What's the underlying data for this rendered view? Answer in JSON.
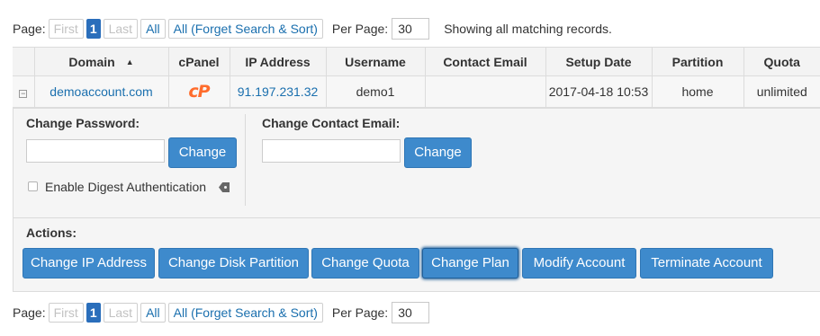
{
  "pager": {
    "page_label": "Page:",
    "first": "First",
    "current_page": "1",
    "last": "Last",
    "all": "All",
    "all_forget": "All (Forget Search & Sort)",
    "per_page_label": "Per Page:",
    "per_page_value": "30",
    "showing_text": "Showing all matching records."
  },
  "table": {
    "columns": [
      "",
      "Domain",
      "cPanel",
      "IP Address",
      "Username",
      "Contact Email",
      "Setup Date",
      "Partition",
      "Quota"
    ],
    "sort_indicator": "▲",
    "rows": [
      {
        "expander": "−",
        "domain": "demoaccount.com",
        "cpanel_logo": "cP",
        "ip": "91.197.231.32",
        "username": "demo1",
        "contact_email": "",
        "setup_date": "2017-04-18 10:53",
        "partition": "home",
        "quota": "unlimited"
      }
    ]
  },
  "detail": {
    "change_password_label": "Change Password:",
    "change_password_value": "",
    "change_password_button": "Change",
    "enable_digest_label": "Enable Digest Authentication",
    "change_email_label": "Change Contact Email:",
    "change_email_value": "",
    "change_email_button": "Change",
    "actions_label": "Actions:",
    "actions": [
      "Change IP Address",
      "Change Disk Partition",
      "Change Quota",
      "Change Plan",
      "Modify Account",
      "Terminate Account"
    ]
  },
  "colors": {
    "accent": "#3e8acc",
    "link": "#1a6fae",
    "cpanel_logo": "#ff6c2c"
  }
}
